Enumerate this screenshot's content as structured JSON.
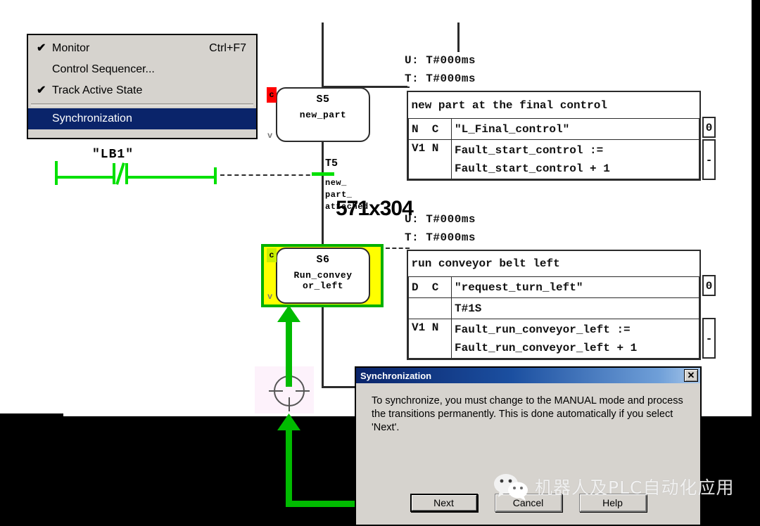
{
  "context_menu": {
    "items": [
      {
        "label": "Monitor",
        "accel": "Ctrl+F7",
        "check": "✔",
        "selected": false
      },
      {
        "label": "Control Sequencer...",
        "accel": "",
        "check": "",
        "selected": false
      },
      {
        "label": "Track Active State",
        "accel": "",
        "check": "✔",
        "selected": false
      },
      {
        "label": "Synchronization",
        "accel": "",
        "check": "",
        "selected": true
      }
    ]
  },
  "lad": {
    "contact_label": "\"LB1\""
  },
  "size_overlay": "571x304",
  "steps": [
    {
      "name": "S5",
      "label": "new_part",
      "badge_top": "c",
      "badge_bottom": "v",
      "selected": false,
      "time_u": "U: T#000ms",
      "time_t": "T: T#000ms",
      "action_header": "new part at the final control",
      "rows": [
        {
          "qual": "N  C",
          "text": "\"L_Final_control\"",
          "value": "0"
        },
        {
          "qual": "V1 N",
          "text": "Fault_start_control :=\nFault_start_control + 1",
          "value": "-"
        }
      ]
    },
    {
      "name": "S6",
      "label": "Run_convey\nor_left",
      "badge_top": "c",
      "badge_bottom": "v",
      "selected": true,
      "time_u": "U: T#000ms",
      "time_t": "T: T#000ms",
      "action_header": "run conveyor belt left",
      "rows": [
        {
          "qual": "D  C",
          "text": "\"request_turn_left\"",
          "value": "0"
        },
        {
          "qual": "",
          "text": "T#1S",
          "value": ""
        },
        {
          "qual": "V1 N",
          "text": "Fault_run_conveyor_left :=\nFault_run_conveyor_left + 1",
          "value": "-"
        }
      ]
    }
  ],
  "transition": {
    "name": "T5",
    "desc": "new_\npart_\nattached"
  },
  "dialog": {
    "title": "Synchronization",
    "close_label": "✕",
    "message": "To synchronize, you must change to the MANUAL mode and process the transitions permanently. This is done automatically if you select 'Next'.",
    "buttons": [
      {
        "label": "Next",
        "default": true
      },
      {
        "label": "Cancel",
        "default": false
      },
      {
        "label": "Help",
        "default": false
      }
    ]
  },
  "watermark": {
    "text": "机器人及PLC自动化应用"
  },
  "colors": {
    "selection_border": "#00b000",
    "selection_fill": "#ffff00",
    "active_green": "#00e000",
    "alarm_red": "#ff0000",
    "menu_highlight": "#0a246a",
    "dialog_face": "#d6d3ce"
  }
}
